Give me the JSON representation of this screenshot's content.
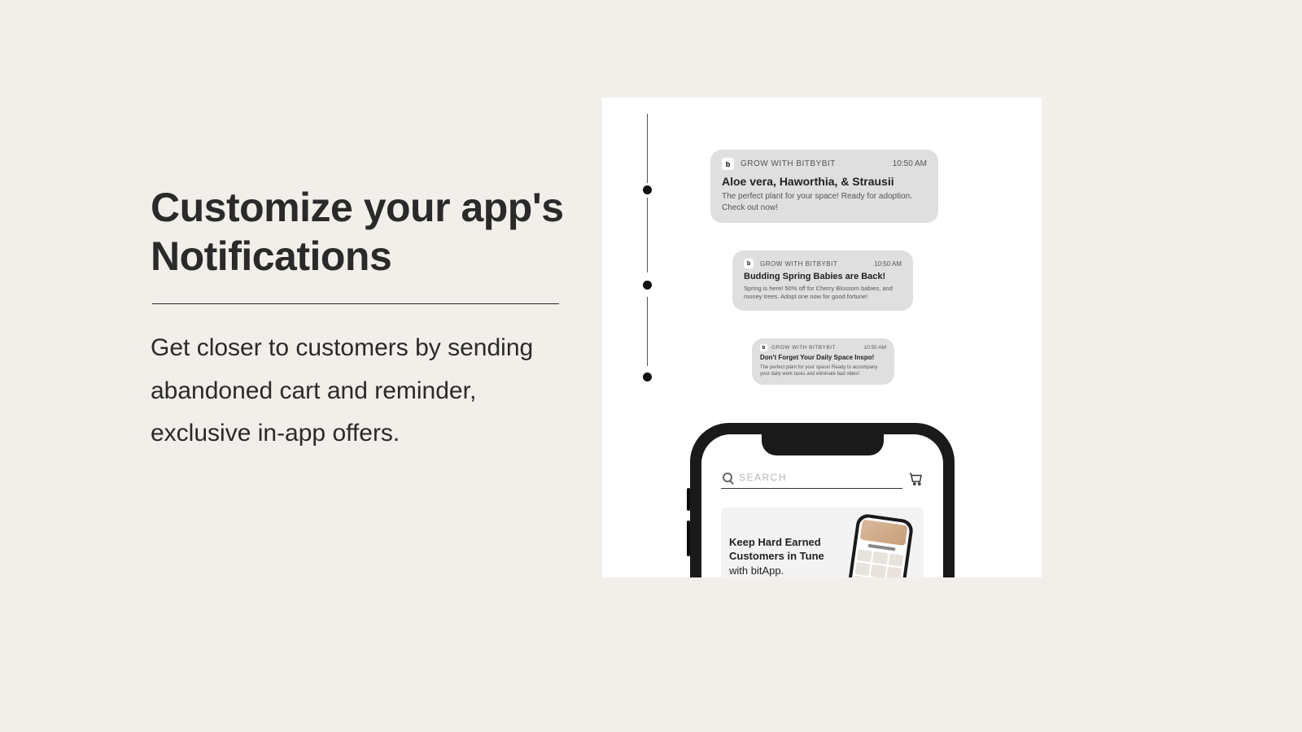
{
  "heading": "Customize your app's Notifications",
  "subtext": "Get closer to customers by sending abandoned cart and reminder, exclusive in-app offers.",
  "notifications": [
    {
      "app": "GROW WITH BITBYBIT",
      "time": "10:50 AM",
      "title": "Aloe vera, Haworthia, & Strausii",
      "body": "The perfect plant for your space!  Ready for adoption. Check out now!"
    },
    {
      "app": "GROW WITH BITBYBIT",
      "time": "10:50 AM",
      "title": "Budding Spring Babies are Back!",
      "body": "Spring is here! 50% off for Cherry Blossom babies, and money trees. Adopt one now for good fortune!"
    },
    {
      "app": "GROW WITH BITBYBIT",
      "time": "10:50 AM",
      "title": "Don't Forget Your Daily Space Inspo!",
      "body": "The perfect plant for your space!  Ready to accompany your daily work tasks and eliminate bad vibes!"
    }
  ],
  "phone": {
    "search_placeholder": "SEARCH",
    "promo_bold": "Keep Hard Earned Customers in Tune",
    "promo_light": "with bitApp."
  },
  "logo_letter": "b"
}
